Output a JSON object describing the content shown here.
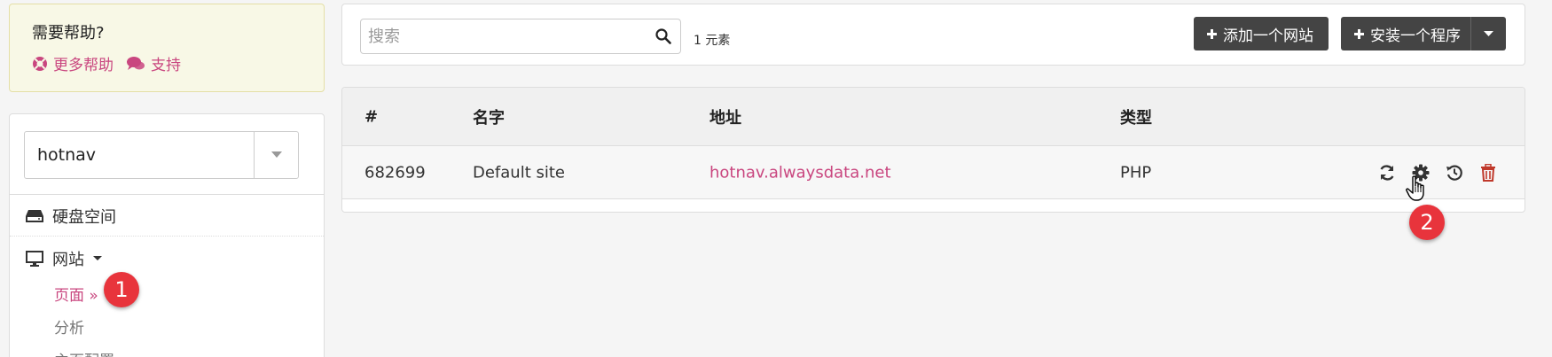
{
  "help": {
    "title": "需要帮助?",
    "more_help": "更多帮助",
    "support": "支持"
  },
  "sidebar": {
    "account": "hotnav",
    "items": [
      {
        "label": "硬盘空间",
        "icon": "hdd-icon"
      },
      {
        "label": "网站",
        "icon": "monitor-icon"
      }
    ],
    "subitems": [
      {
        "label": "页面 »",
        "active": true
      },
      {
        "label": "分析",
        "active": false
      },
      {
        "label": "主页配置",
        "active": false
      }
    ]
  },
  "toolbar": {
    "search_placeholder": "搜索",
    "count": "1 元素",
    "add_site": "添加一个网站",
    "install_app": "安装一个程序"
  },
  "table": {
    "headers": [
      "#",
      "名字",
      "地址",
      "类型"
    ],
    "rows": [
      {
        "id": "682699",
        "name": "Default site",
        "address": "hotnav.alwaysdata.net",
        "type": "PHP"
      }
    ]
  },
  "annotations": [
    "1",
    "2"
  ],
  "colors": {
    "accent": "#c9467f",
    "dark_button": "#444444",
    "badge": "#e8343c",
    "danger": "#c0392b"
  }
}
